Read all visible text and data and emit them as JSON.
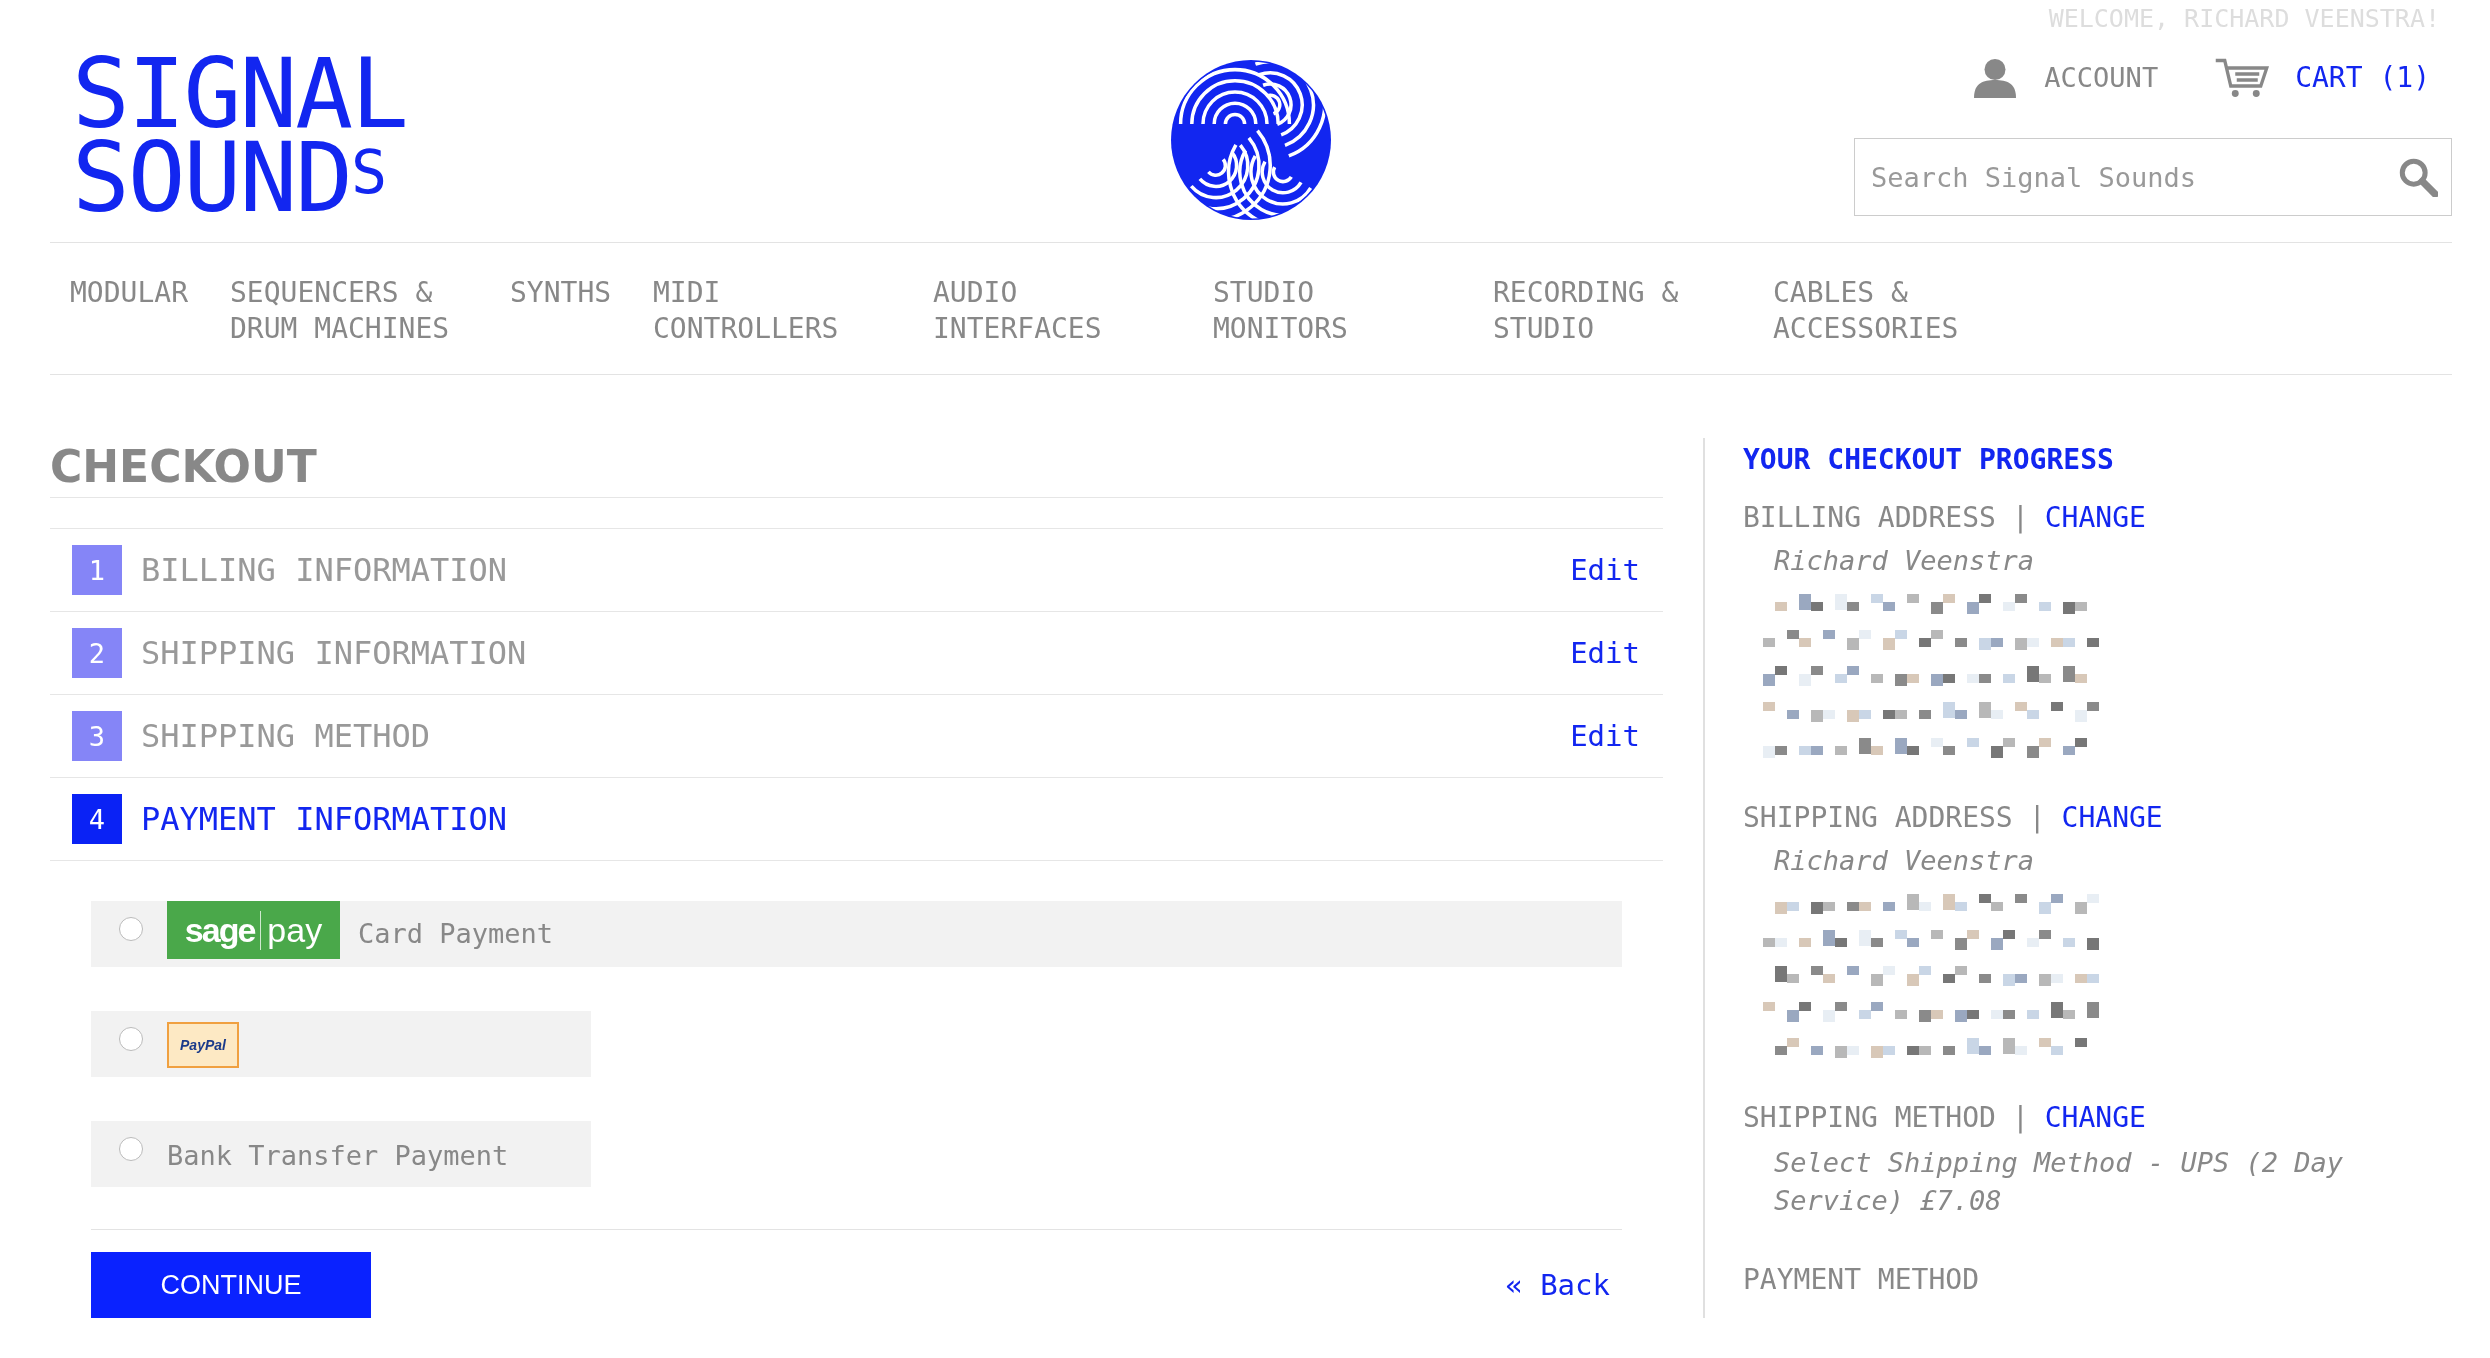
{
  "welcome": "WELCOME, RICHARD VEENSTRA!",
  "logo": {
    "lines": [
      "SIGNAL",
      "SOUND$^{S}$"
    ]
  },
  "account": "ACCOUNT",
  "cart": "CART (1)",
  "search": {
    "placeholder": "Search Signal Sounds"
  },
  "nav": [
    {
      "label": "MODULAR"
    },
    {
      "label": "SEQUENCERS &\nDRUM MACHINES"
    },
    {
      "label": "SYNTHS"
    },
    {
      "label": "MIDI\nCONTROLLERS"
    },
    {
      "label": "AUDIO\nINTERFACES"
    },
    {
      "label": "STUDIO\nMONITORS"
    },
    {
      "label": "RECORDING &\nSTUDIO"
    },
    {
      "label": "CABLES &\nACCESSORIES"
    }
  ],
  "checkout": {
    "title": "CHECKOUT",
    "steps": [
      {
        "number": "1",
        "title": "BILLING INFORMATION",
        "edit": "Edit",
        "active": false
      },
      {
        "number": "2",
        "title": "SHIPPING INFORMATION",
        "edit": "Edit",
        "active": false
      },
      {
        "number": "3",
        "title": "SHIPPING METHOD",
        "edit": "Edit",
        "active": false
      },
      {
        "number": "4",
        "title": "PAYMENT INFORMATION",
        "active": true
      }
    ],
    "payment_options": [
      {
        "kind": "sagepay",
        "logo": [
          "sage",
          "pay"
        ],
        "label": "Card Payment",
        "selected": false
      },
      {
        "kind": "paypal",
        "logo": [
          "PayPal"
        ],
        "selected": false
      },
      {
        "kind": "plain",
        "label": "Bank Transfer Payment",
        "selected": false
      }
    ],
    "continue": "CONTINUE",
    "back": "« Back"
  },
  "progress": {
    "title": "YOUR CHECKOUT PROGRESS",
    "sections": [
      {
        "title": "BILLING ADDRESS",
        "separator": "|",
        "change": "CHANGE",
        "name": "Richard Veenstra",
        "address": [
          {
            "kind": "redacted"
          },
          {
            "kind": "redacted"
          },
          {
            "kind": "redacted"
          },
          {
            "kind": "redacted"
          },
          {
            "kind": "redacted"
          }
        ]
      },
      {
        "title": "SHIPPING ADDRESS",
        "separator": "|",
        "change": "CHANGE",
        "name": "Richard Veenstra",
        "address": [
          {
            "kind": "redacted"
          },
          {
            "kind": "redacted"
          },
          {
            "kind": "redacted"
          },
          {
            "kind": "redacted"
          },
          {
            "kind": "redacted"
          }
        ]
      },
      {
        "title": "SHIPPING METHOD",
        "separator": "|",
        "change": "CHANGE",
        "details": "Select Shipping Method - UPS (2 Day Service) £7.08"
      },
      {
        "title": "PAYMENT METHOD"
      }
    ]
  }
}
